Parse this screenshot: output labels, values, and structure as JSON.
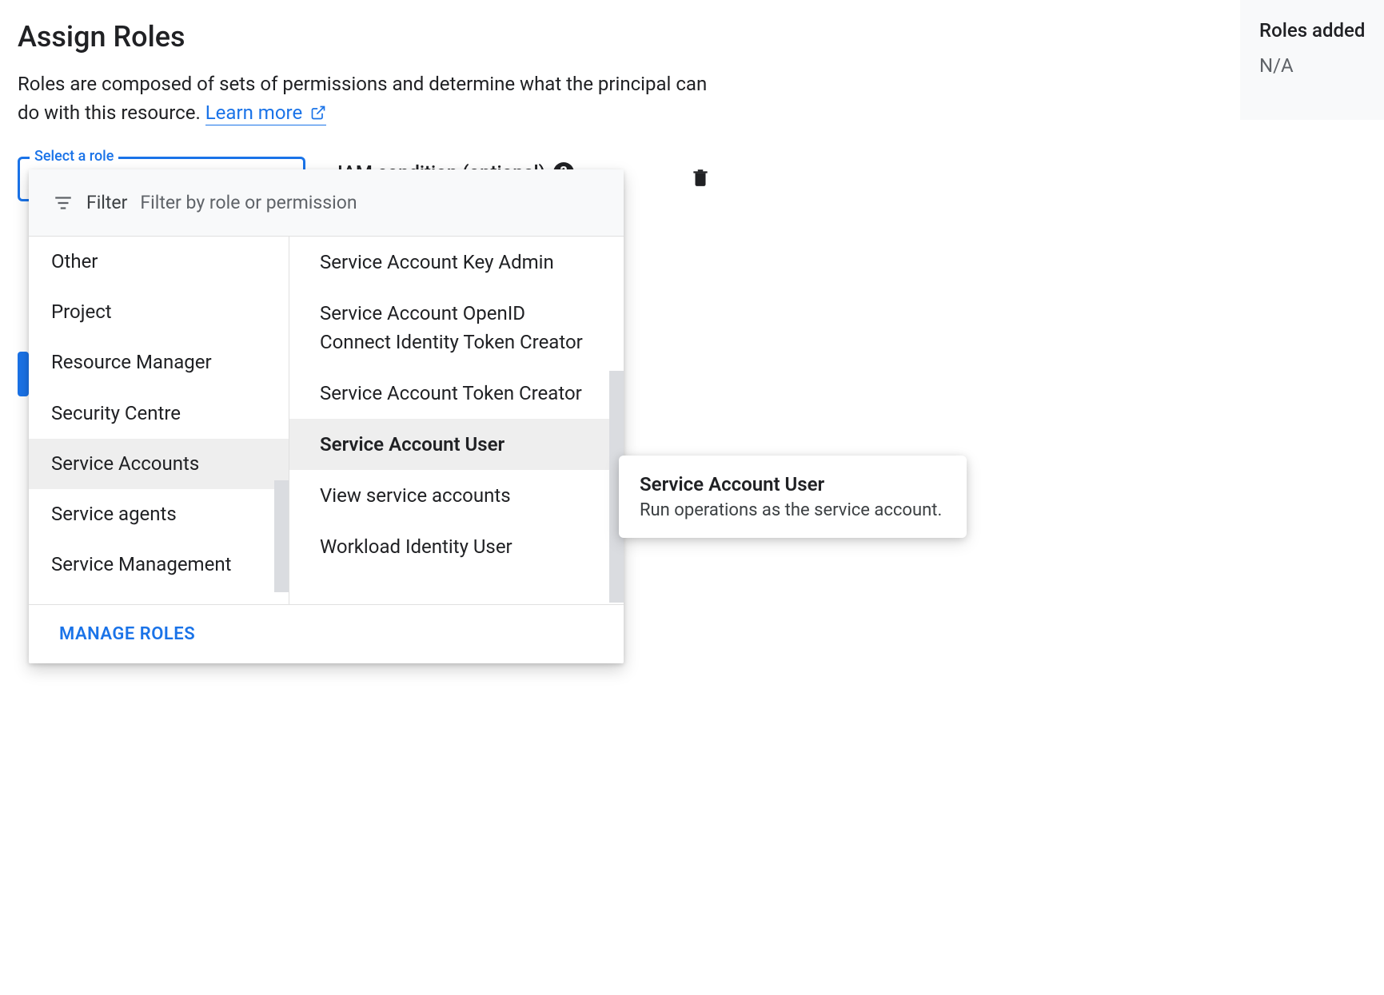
{
  "header": {
    "title": "Assign Roles",
    "description_pre": "Roles are composed of sets of permissions and determine what the principal can do with this resource. ",
    "learn_more": "Learn more"
  },
  "role_field": {
    "label": "Select a role"
  },
  "iam_condition": {
    "label": "IAM condition (optional)"
  },
  "dropdown": {
    "filter_label": "Filter",
    "filter_placeholder": "Filter by role or permission",
    "left_items": [
      {
        "label": "Other",
        "selected": false
      },
      {
        "label": "Project",
        "selected": false
      },
      {
        "label": "Resource Manager",
        "selected": false
      },
      {
        "label": "Security Centre",
        "selected": false
      },
      {
        "label": "Service Accounts",
        "selected": true
      },
      {
        "label": "Service agents",
        "selected": false
      },
      {
        "label": "Service Management",
        "selected": false
      }
    ],
    "right_items": [
      {
        "label": "Service Account Key Admin",
        "highlighted": false
      },
      {
        "label": "Service Account OpenID Connect Identity Token Creator",
        "highlighted": false
      },
      {
        "label": "Service Account Token Creator",
        "highlighted": false
      },
      {
        "label": "Service Account User",
        "highlighted": true
      },
      {
        "label": "View service accounts",
        "highlighted": false
      },
      {
        "label": "Workload Identity User",
        "highlighted": false
      }
    ],
    "manage_roles": "MANAGE ROLES"
  },
  "tooltip": {
    "title": "Service Account User",
    "description": "Run operations as the service account."
  },
  "sidebar": {
    "title": "Roles added",
    "value": "N/A"
  }
}
